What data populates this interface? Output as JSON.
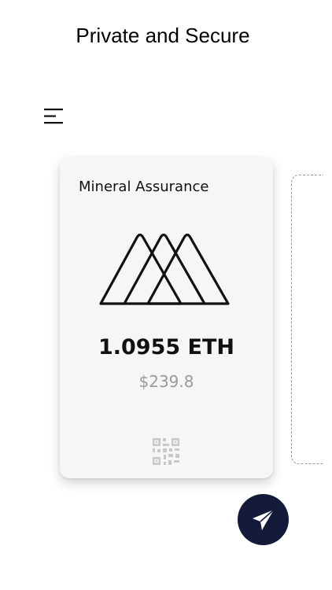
{
  "header": {
    "title": "Private and Secure"
  },
  "menu": {
    "icon": "hamburger-menu-icon"
  },
  "wallet_card": {
    "name": "Mineral Assurance",
    "logo_icon": "triple-peak-logo",
    "balance": "1.0955 ETH",
    "fiat_value": "$239.8",
    "qr_icon": "qr-code-icon"
  },
  "send_button": {
    "icon": "paper-plane-icon",
    "color": "#151a3b"
  },
  "colors": {
    "card_background": "#f6f6f6",
    "fiat_text": "#9a9aa0",
    "accent": "#151a3b"
  }
}
